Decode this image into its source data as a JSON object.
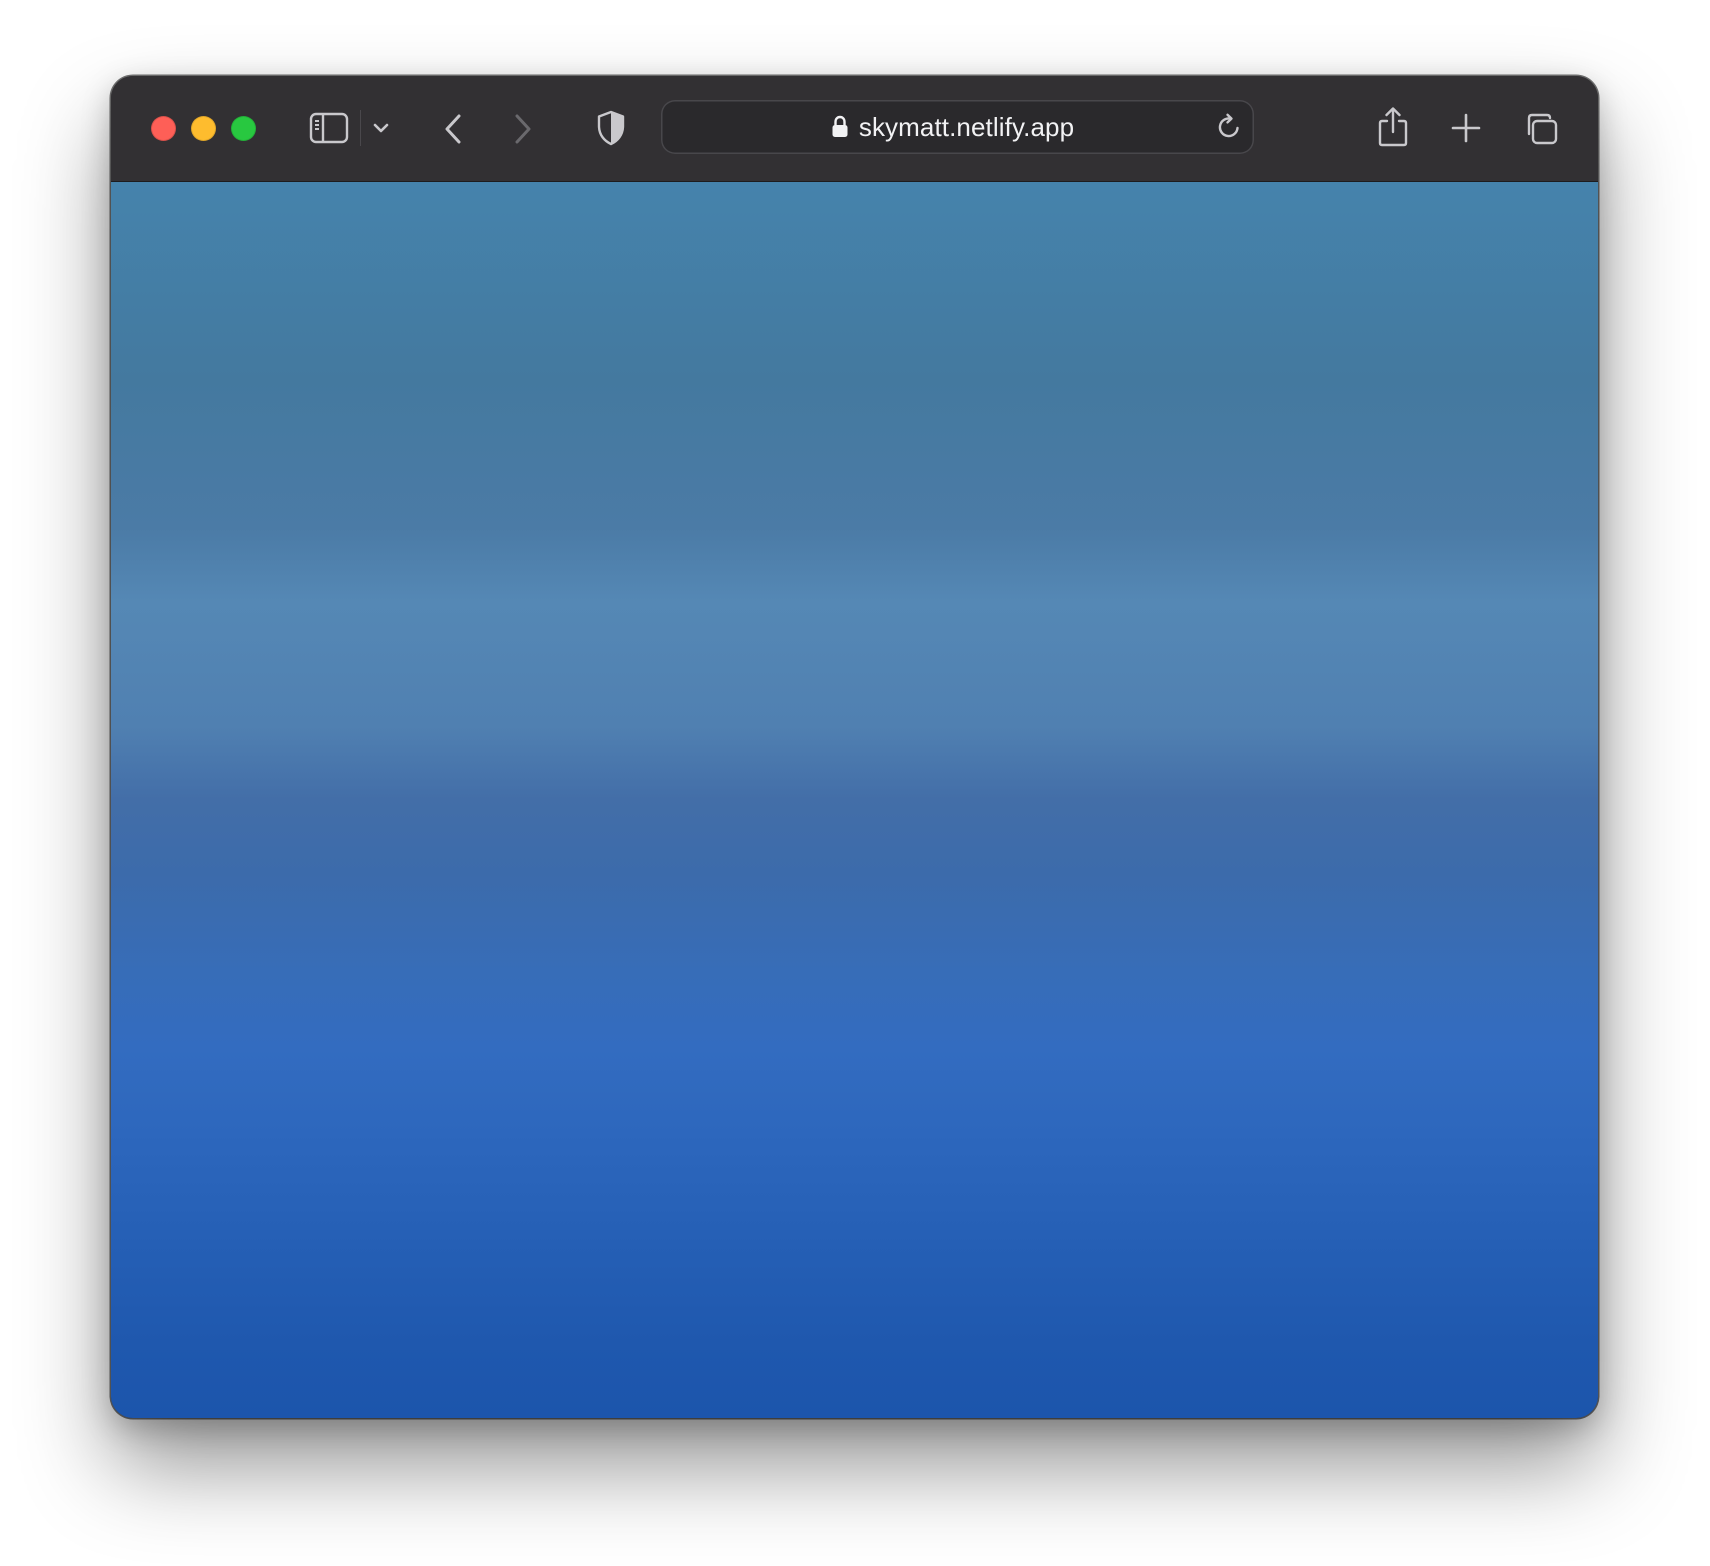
{
  "browser": {
    "url": "skymatt.netlify.app",
    "icons": {
      "close": "close-window-dot",
      "minimize": "minimize-window-dot",
      "maximize": "maximize-window-dot",
      "sidebar": "sidebar-icon",
      "tab_group": "chevron-down-icon",
      "back": "chevron-left-icon",
      "forward": "chevron-right-icon",
      "privacy": "shield-icon",
      "lock": "lock-icon",
      "reload": "reload-icon",
      "share": "share-icon",
      "new_tab": "plus-icon",
      "tab_overview": "tabs-overview-icon"
    },
    "colors": {
      "toolbar": "#323033",
      "close": "#fe5f57",
      "minimize": "#febc2e",
      "maximize": "#28c840",
      "sky_top": "#4583ac",
      "sky_mid": "#5588b5",
      "sky_bottom": "#1c55ac"
    }
  }
}
